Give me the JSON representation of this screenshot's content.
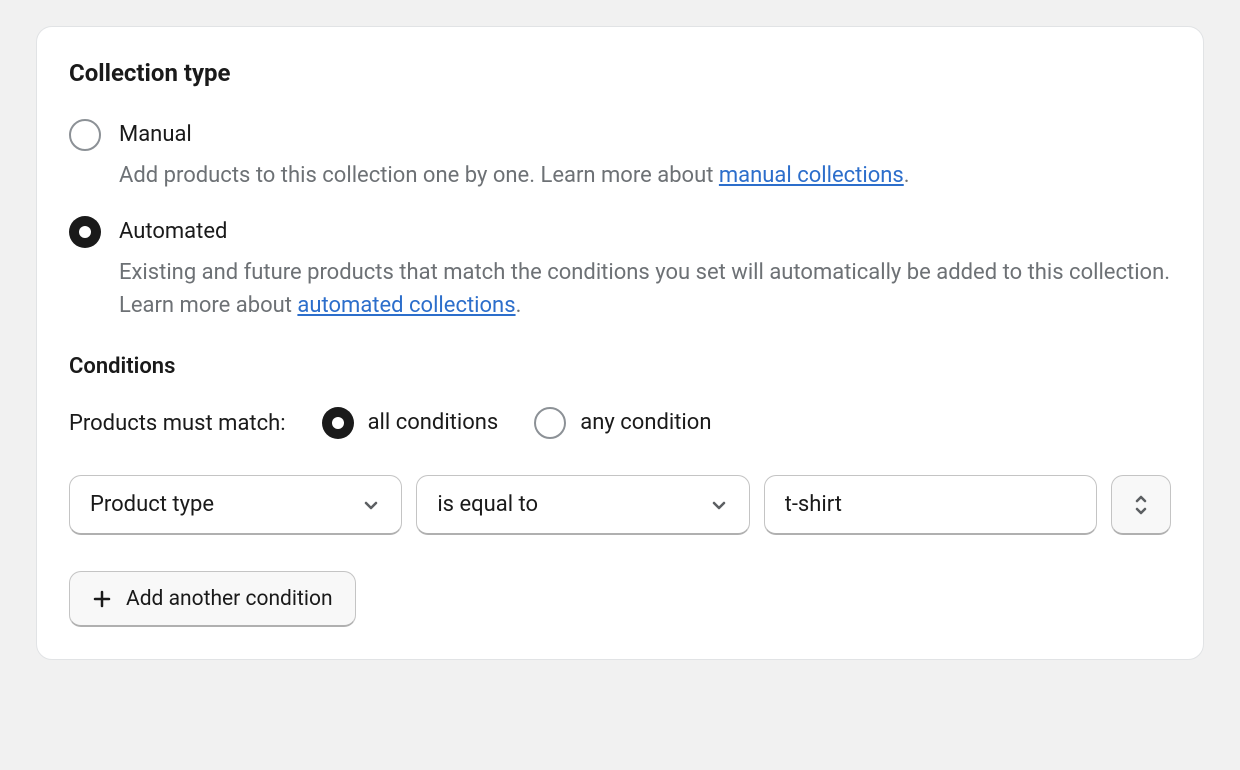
{
  "collection_type": {
    "title": "Collection type",
    "options": [
      {
        "label": "Manual",
        "description_pre": "Add products to this collection one by one. Learn more about ",
        "link_text": "manual collections",
        "description_post": ".",
        "checked": false
      },
      {
        "label": "Automated",
        "description_pre": "Existing and future products that match the conditions you set will automatically be added to this collection. Learn more about ",
        "link_text": "automated collections",
        "description_post": ".",
        "checked": true
      }
    ]
  },
  "conditions": {
    "title": "Conditions",
    "match_label": "Products must match:",
    "match_options": [
      {
        "label": "all conditions",
        "checked": true
      },
      {
        "label": "any condition",
        "checked": false
      }
    ],
    "rows": [
      {
        "field": "Product type",
        "operator": "is equal to",
        "value": "t-shirt"
      }
    ],
    "add_button": "Add another condition"
  }
}
